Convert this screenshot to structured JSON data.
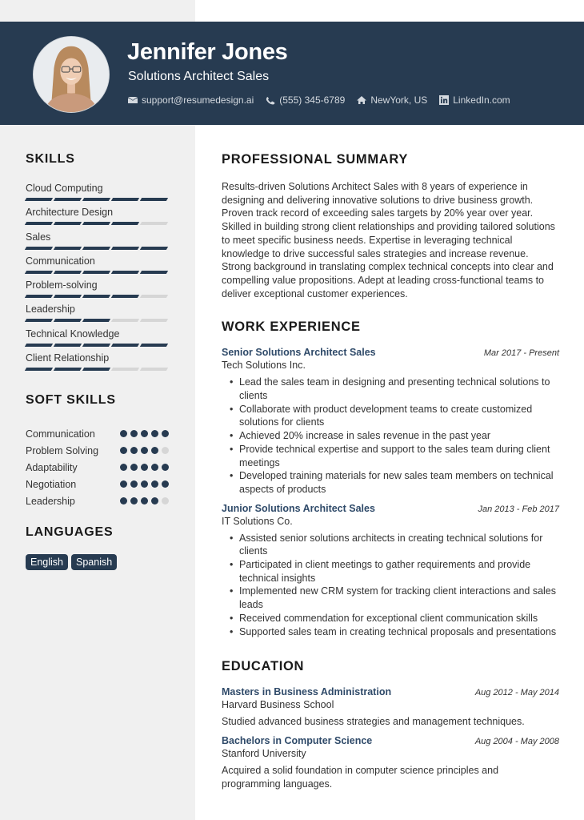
{
  "header": {
    "name": "Jennifer Jones",
    "title": "Solutions Architect Sales",
    "contacts": [
      {
        "icon": "envelope-icon",
        "text": "support@resumedesign.ai"
      },
      {
        "icon": "phone-icon",
        "text": "(555) 345-6789"
      },
      {
        "icon": "home-icon",
        "text": "NewYork, US"
      },
      {
        "icon": "linkedin-icon",
        "text": "LinkedIn.com"
      }
    ]
  },
  "colors": {
    "accent": "#273b51",
    "sidebar_bg": "#f0f0f0",
    "inactive": "#d6d6d6",
    "job_title": "#2f4a69"
  },
  "sidebar": {
    "skills_heading": "SKILLS",
    "skills": [
      {
        "label": "Cloud Computing",
        "level": 5,
        "max": 5
      },
      {
        "label": "Architecture Design",
        "level": 4,
        "max": 5
      },
      {
        "label": "Sales",
        "level": 5,
        "max": 5
      },
      {
        "label": "Communication",
        "level": 5,
        "max": 5
      },
      {
        "label": "Problem-solving",
        "level": 4,
        "max": 5
      },
      {
        "label": "Leadership",
        "level": 3,
        "max": 5
      },
      {
        "label": "Technical Knowledge",
        "level": 5,
        "max": 5
      },
      {
        "label": "Client Relationship",
        "level": 3,
        "max": 5
      }
    ],
    "soft_skills_heading": "SOFT SKILLS",
    "soft_skills": [
      {
        "label": "Communication",
        "level": 5,
        "max": 5
      },
      {
        "label": "Problem Solving",
        "level": 4,
        "max": 5
      },
      {
        "label": "Adaptability",
        "level": 5,
        "max": 5
      },
      {
        "label": "Negotiation",
        "level": 5,
        "max": 5
      },
      {
        "label": "Leadership",
        "level": 4,
        "max": 5
      }
    ],
    "languages_heading": "LANGUAGES",
    "languages": [
      "English",
      "Spanish"
    ]
  },
  "main": {
    "summary_heading": "PROFESSIONAL SUMMARY",
    "summary": "Results-driven Solutions Architect Sales with 8 years of experience in designing and delivering innovative solutions to drive business growth. Proven track record of exceeding sales targets by 20% year over year. Skilled in building strong client relationships and providing tailored solutions to meet specific business needs. Expertise in leveraging technical knowledge to drive successful sales strategies and increase revenue. Strong background in translating complex technical concepts into clear and compelling value propositions. Adept at leading cross-functional teams to deliver exceptional customer experiences.",
    "work_heading": "WORK EXPERIENCE",
    "jobs": [
      {
        "title": "Senior Solutions Architect Sales",
        "date": "Mar 2017 - Present",
        "company": "Tech Solutions Inc.",
        "bullets": [
          "Lead the sales team in designing and presenting technical solutions to clients",
          "Collaborate with product development teams to create customized solutions for clients",
          "Achieved 20% increase in sales revenue in the past year",
          "Provide technical expertise and support to the sales team during client meetings",
          "Developed training materials for new sales team members on technical aspects of products"
        ]
      },
      {
        "title": "Junior Solutions Architect Sales",
        "date": "Jan 2013 - Feb 2017",
        "company": "IT Solutions Co.",
        "bullets": [
          "Assisted senior solutions architects in creating technical solutions for clients",
          "Participated in client meetings to gather requirements and provide technical insights",
          "Implemented new CRM system for tracking client interactions and sales leads",
          "Received commendation for exceptional client communication skills",
          "Supported sales team in creating technical proposals and presentations"
        ]
      }
    ],
    "education_heading": "EDUCATION",
    "education": [
      {
        "degree": "Masters in Business Administration",
        "date": "Aug 2012 - May 2014",
        "school": "Harvard Business School",
        "description": "Studied advanced business strategies and management techniques."
      },
      {
        "degree": "Bachelors in Computer Science",
        "date": "Aug 2004 - May 2008",
        "school": "Stanford University",
        "description": "Acquired a solid foundation in computer science principles and programming languages."
      }
    ]
  }
}
